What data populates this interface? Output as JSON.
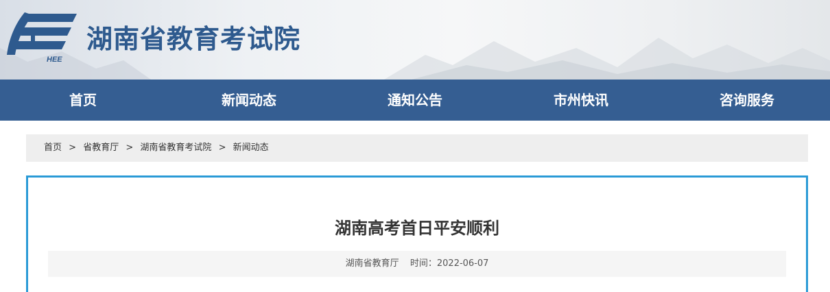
{
  "header": {
    "logo_text": "HEE",
    "site_title": "湖南省教育考试院"
  },
  "nav": {
    "items": [
      {
        "label": "首页"
      },
      {
        "label": "新闻动态"
      },
      {
        "label": "通知公告"
      },
      {
        "label": "市州快讯"
      },
      {
        "label": "咨询服务"
      }
    ]
  },
  "breadcrumb": {
    "items": [
      {
        "label": "首页"
      },
      {
        "label": "省教育厅"
      },
      {
        "label": "湖南省教育考试院"
      },
      {
        "label": "新闻动态"
      }
    ],
    "separator": ">"
  },
  "article": {
    "title": "湖南高考首日平安顺利",
    "source": "湖南省教育厅",
    "time_label": "时间：",
    "date": "2022-06-07"
  },
  "colors": {
    "nav_bg": "#355e92",
    "title_blue": "#2e5a8e",
    "content_border": "#2a9ad6"
  }
}
